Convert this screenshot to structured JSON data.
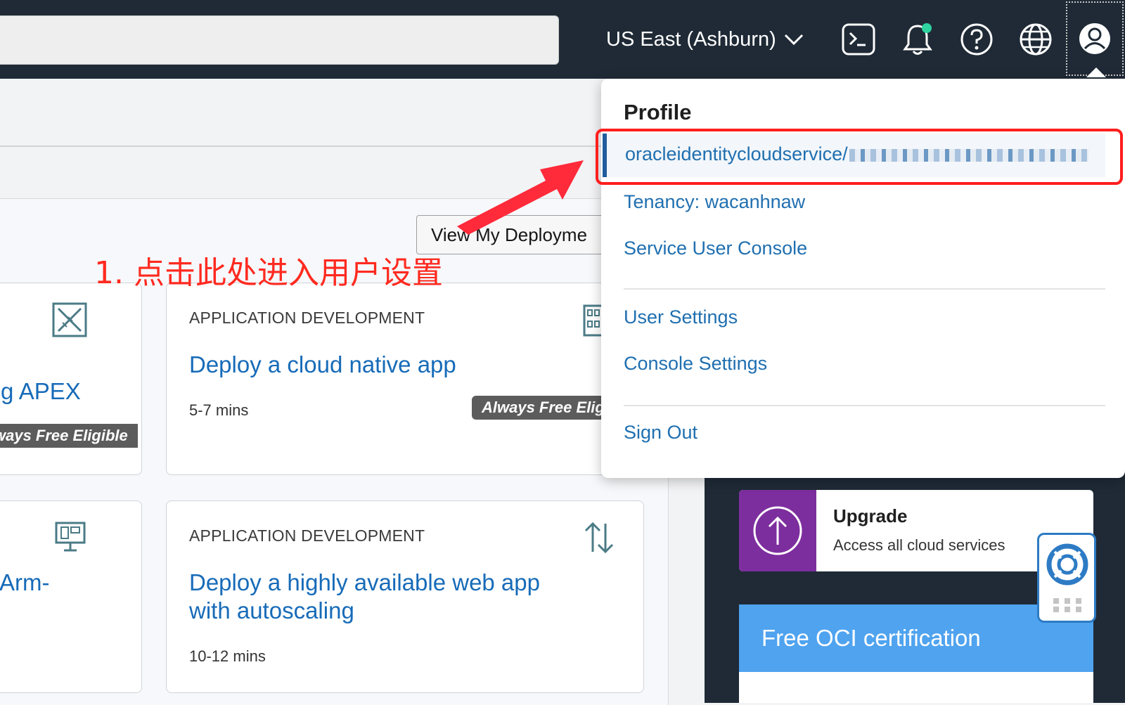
{
  "topbar": {
    "region": "US East (Ashburn)"
  },
  "main": {
    "deploy_button": "View My Deployme",
    "cards": [
      {
        "title": "g APEX",
        "badge": "ways Free Eligible"
      },
      {
        "category": "APPLICATION DEVELOPMENT",
        "title": "Deploy a cloud native app",
        "duration": "5-7 mins",
        "badge": "Always Free Elig"
      },
      {
        "title": "Arm-"
      },
      {
        "category": "APPLICATION DEVELOPMENT",
        "title_line1": "Deploy a highly available web app",
        "title_line2": "with autoscaling",
        "duration": "10-12 mins"
      }
    ]
  },
  "annotation": {
    "text": "1. 点击此处进入用户设置"
  },
  "profile_menu": {
    "heading": "Profile",
    "user_prefix": "oracleidentitycloudservice/",
    "tenancy": "Tenancy: wacanhnaw",
    "service_user_console": "Service User Console",
    "user_settings": "User Settings",
    "console_settings": "Console Settings",
    "sign_out": "Sign Out"
  },
  "sidebar": {
    "upgrade_title": "Upgrade",
    "upgrade_desc": "Access all cloud services",
    "cert_title": "Free OCI certification"
  },
  "colors": {
    "topbar": "#1f2a36",
    "link": "#176bb8",
    "annotation": "#ff2a20",
    "upgrade_icon_bg": "#7d2e9e",
    "cert_header": "#4fa3ef"
  },
  "icons": [
    "terminal-icon",
    "bell-icon",
    "help-icon",
    "globe-icon",
    "user-avatar-icon",
    "chevron-down-icon",
    "ruler-pencil-icon",
    "building-icon",
    "monitor-icon",
    "sort-arrows-icon",
    "arrow-up-circle-icon",
    "lifebuoy-icon",
    "grid-icon"
  ]
}
